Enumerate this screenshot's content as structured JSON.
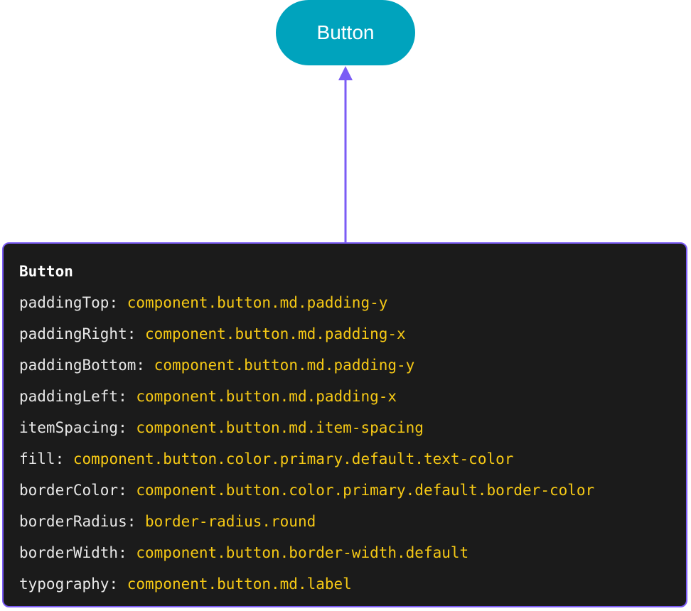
{
  "colors": {
    "button_fill": "#00a3bd",
    "connector": "#7b5cf5",
    "panel_background": "#1b1b1b",
    "panel_border": "#7b5cf5",
    "property_text": "#e8e8e8",
    "token_text": "#f6c915"
  },
  "button": {
    "label": "Button"
  },
  "panel": {
    "title": "Button",
    "separator": ": ",
    "properties": [
      {
        "name": "paddingTop",
        "token": "component.button.md.padding-y"
      },
      {
        "name": "paddingRight",
        "token": "component.button.md.padding-x"
      },
      {
        "name": "paddingBottom",
        "token": "component.button.md.padding-y"
      },
      {
        "name": "paddingLeft",
        "token": "component.button.md.padding-x"
      },
      {
        "name": "itemSpacing",
        "token": "component.button.md.item-spacing"
      },
      {
        "name": "fill",
        "token": "component.button.color.primary.default.text-color"
      },
      {
        "name": "borderColor",
        "token": "component.button.color.primary.default.border-color"
      },
      {
        "name": "borderRadius",
        "token": "border-radius.round"
      },
      {
        "name": "borderWidth",
        "token": "component.button.border-width.default"
      },
      {
        "name": "typography",
        "token": "component.button.md.label"
      }
    ]
  }
}
